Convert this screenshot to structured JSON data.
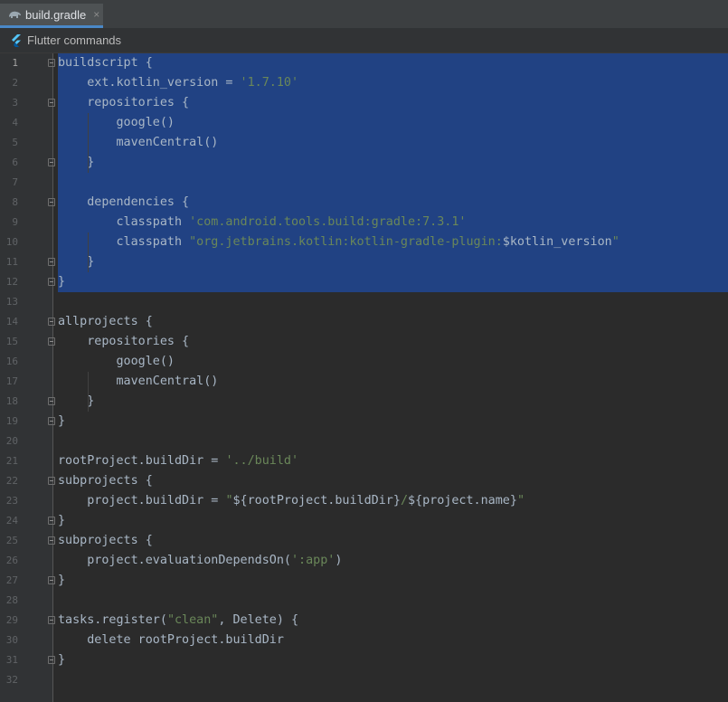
{
  "tab": {
    "title": "build.gradle",
    "close": "×"
  },
  "toolbar": {
    "flutter_commands": "Flutter commands"
  },
  "editor": {
    "current_line": 1,
    "selected_lines": [
      1,
      2,
      3,
      4,
      5,
      6,
      7,
      8,
      9,
      10,
      11,
      12
    ],
    "lines": [
      {
        "n": "1",
        "fold": true,
        "segs": [
          {
            "t": "buildscript {"
          }
        ]
      },
      {
        "n": "2",
        "segs": [
          {
            "t": "    ext.kotlin_version = "
          },
          {
            "t": "'1.7.10'",
            "s": 1
          }
        ]
      },
      {
        "n": "3",
        "fold": true,
        "segs": [
          {
            "t": "    repositories {"
          }
        ]
      },
      {
        "n": "4",
        "segs": [
          {
            "t": "        google()"
          }
        ]
      },
      {
        "n": "5",
        "segs": [
          {
            "t": "        mavenCentral()"
          }
        ]
      },
      {
        "n": "6",
        "fold": true,
        "segs": [
          {
            "t": "    }"
          }
        ]
      },
      {
        "n": "7",
        "segs": []
      },
      {
        "n": "8",
        "fold": true,
        "segs": [
          {
            "t": "    dependencies {"
          }
        ]
      },
      {
        "n": "9",
        "segs": [
          {
            "t": "        classpath "
          },
          {
            "t": "'com.android.tools.build:gradle:7.3.1'",
            "s": 1
          }
        ]
      },
      {
        "n": "10",
        "segs": [
          {
            "t": "        classpath "
          },
          {
            "t": "\"org.jetbrains.kotlin:kotlin-gradle-plugin:",
            "s": 1
          },
          {
            "t": "$kotlin_version"
          },
          {
            "t": "\"",
            "s": 1
          }
        ]
      },
      {
        "n": "11",
        "fold": true,
        "segs": [
          {
            "t": "    }"
          }
        ]
      },
      {
        "n": "12",
        "fold": true,
        "segs": [
          {
            "t": "}"
          }
        ]
      },
      {
        "n": "13",
        "segs": []
      },
      {
        "n": "14",
        "fold": true,
        "segs": [
          {
            "t": "allprojects {"
          }
        ]
      },
      {
        "n": "15",
        "fold": true,
        "segs": [
          {
            "t": "    repositories {"
          }
        ]
      },
      {
        "n": "16",
        "segs": [
          {
            "t": "        google()"
          }
        ]
      },
      {
        "n": "17",
        "segs": [
          {
            "t": "        mavenCentral()"
          }
        ]
      },
      {
        "n": "18",
        "fold": true,
        "segs": [
          {
            "t": "    }"
          }
        ]
      },
      {
        "n": "19",
        "fold": true,
        "segs": [
          {
            "t": "}"
          }
        ]
      },
      {
        "n": "20",
        "segs": []
      },
      {
        "n": "21",
        "segs": [
          {
            "t": "rootProject.buildDir = "
          },
          {
            "t": "'../build'",
            "s": 1
          }
        ]
      },
      {
        "n": "22",
        "fold": true,
        "segs": [
          {
            "t": "subprojects {"
          }
        ]
      },
      {
        "n": "23",
        "segs": [
          {
            "t": "    project.buildDir = "
          },
          {
            "t": "\"",
            "s": 1
          },
          {
            "t": "${rootProject.buildDir}"
          },
          {
            "t": "/",
            "s": 1
          },
          {
            "t": "${project.name}"
          },
          {
            "t": "\"",
            "s": 1
          }
        ]
      },
      {
        "n": "24",
        "fold": true,
        "segs": [
          {
            "t": "}"
          }
        ]
      },
      {
        "n": "25",
        "fold": true,
        "segs": [
          {
            "t": "subprojects {"
          }
        ]
      },
      {
        "n": "26",
        "segs": [
          {
            "t": "    project.evaluationDependsOn("
          },
          {
            "t": "':app'",
            "s": 1
          },
          {
            "t": ")"
          }
        ]
      },
      {
        "n": "27",
        "fold": true,
        "segs": [
          {
            "t": "}"
          }
        ]
      },
      {
        "n": "28",
        "segs": []
      },
      {
        "n": "29",
        "fold": true,
        "segs": [
          {
            "t": "tasks.register("
          },
          {
            "t": "\"clean\"",
            "s": 1
          },
          {
            "t": ", Delete) {"
          }
        ]
      },
      {
        "n": "30",
        "segs": [
          {
            "t": "    delete rootProject.buildDir"
          }
        ]
      },
      {
        "n": "31",
        "fold": true,
        "segs": [
          {
            "t": "}"
          }
        ]
      },
      {
        "n": "32",
        "segs": []
      }
    ]
  },
  "colors": {
    "selection": "#214283",
    "string": "#6a8759",
    "text": "#a9b7c6",
    "background": "#2b2b2b"
  },
  "icons": {
    "tab": "gradle-elephant-icon",
    "toolbar": "flutter-icon",
    "fold": "fold-marker-icon"
  }
}
